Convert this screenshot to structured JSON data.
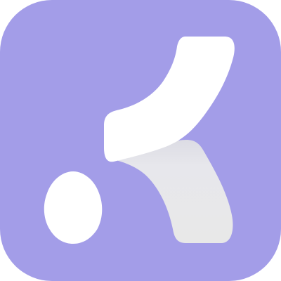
{
  "app_icon": {
    "icon": "k-logo-app-icon",
    "colors": {
      "background": "#A39DE8",
      "foreground": "#FFFFFF",
      "shadow_leg": "#E8E8E8",
      "shadow_soft": "#D6D6E0"
    },
    "parts": {
      "logo_mark": "stylized-k-logo-icon",
      "drop_mark": "water-drop-icon"
    }
  }
}
